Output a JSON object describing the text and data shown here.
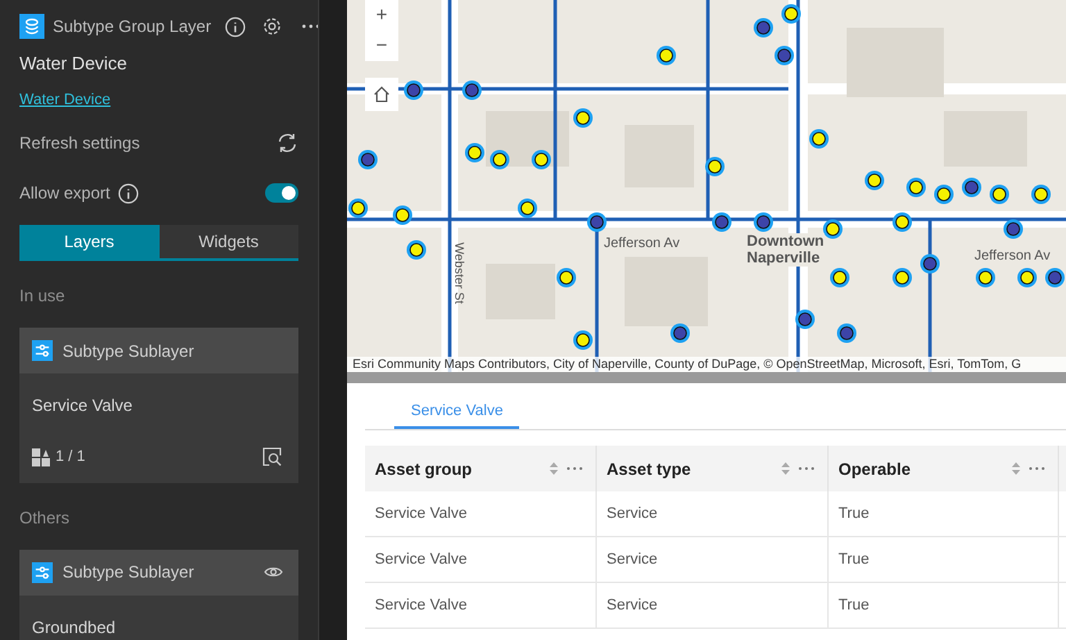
{
  "panel": {
    "title": "Subtype Group Layer",
    "subtitle": "Water Device",
    "link": "Water Device",
    "refresh_label": "Refresh settings",
    "export": {
      "label": "Allow export",
      "on": true
    },
    "tabs": [
      {
        "label": "Layers",
        "selected": true
      },
      {
        "label": "Widgets",
        "selected": false
      }
    ],
    "sections": [
      {
        "heading": "In use",
        "cards": [
          {
            "kind": "in_use",
            "title": "Subtype Sublayer",
            "name": "Service Valve",
            "count": "1 / 1"
          }
        ]
      },
      {
        "heading": "Others",
        "cards": [
          {
            "kind": "other",
            "title": "Subtype Sublayer",
            "name": "Groundbed"
          }
        ]
      }
    ]
  },
  "map": {
    "zoom_in": "+",
    "zoom_out": "−",
    "labels": [
      {
        "text": "Jefferson Av",
        "kind": "street"
      },
      {
        "text": "Downtown\nNaperville",
        "kind": "place"
      },
      {
        "text": "Webster St",
        "kind": "vertical"
      },
      {
        "text": "Jefferson Av",
        "kind": "street_right"
      }
    ],
    "attribution": "Esri Community Maps Contributors, City of Naperville, County of DuPage, © OpenStreetMap, Microsoft, Esri, TomTom, G"
  },
  "table": {
    "tabs": [
      {
        "label": "Service Valve",
        "selected": true
      }
    ],
    "columns": [
      "Asset group",
      "Asset type",
      "Operable"
    ],
    "rows": [
      [
        "Service Valve",
        "Service",
        "True"
      ],
      [
        "Service Valve",
        "Service",
        "True"
      ],
      [
        "Service Valve",
        "Service",
        "True"
      ]
    ]
  }
}
